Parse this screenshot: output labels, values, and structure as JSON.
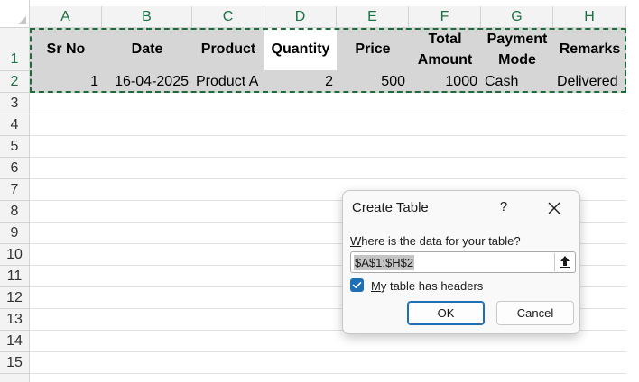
{
  "sheet": {
    "columns": [
      "A",
      "B",
      "C",
      "D",
      "E",
      "F",
      "G",
      "H"
    ],
    "rows": [
      "1",
      "2",
      "3",
      "4",
      "5",
      "6",
      "7",
      "8",
      "9",
      "10",
      "11",
      "12",
      "13",
      "14",
      "15"
    ],
    "headers": [
      "Sr No",
      "Date",
      "Product",
      "Quantity",
      "Price",
      "Total Amount",
      "Payment Mode",
      "Remarks"
    ],
    "data_row": [
      "1",
      "16-04-2025",
      "Product A",
      "2",
      "500",
      "1000",
      "Cash",
      "Delivered"
    ]
  },
  "dialog": {
    "title": "Create Table",
    "help": "?",
    "prompt": "Where is the data for your table?",
    "range_value": "$A$1:$H$2",
    "checkbox_label": "My table has headers",
    "checkbox_checked": true,
    "ok_label": "OK",
    "cancel_label": "Cancel"
  },
  "colors": {
    "accent_green": "#1e7145",
    "accent_blue": "#1f6fb5",
    "selection_grey": "#d6d6d6"
  }
}
